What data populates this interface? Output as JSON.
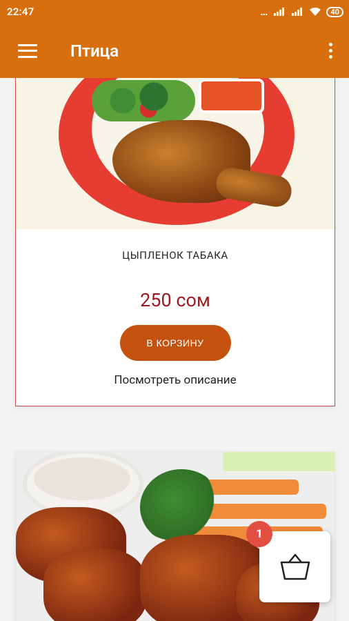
{
  "status_bar": {
    "time": "22:47",
    "battery": "40"
  },
  "app_bar": {
    "title": "Птица"
  },
  "products": [
    {
      "name": "ЦЫПЛЕНОК ТАБАКА",
      "price": "250 сом",
      "add_button": "В КОРЗИНУ",
      "description_link": "Посмотреть описание"
    }
  ],
  "cart": {
    "count": "1"
  },
  "icons": [
    "menu-icon",
    "overflow-menu-icon",
    "shopping-basket-icon",
    "signal-icon",
    "wifi-icon",
    "battery-icon"
  ],
  "colors": {
    "app_bar": "#d86f0f",
    "button": "#c4520e",
    "price": "#9f1b1f",
    "badge": "#e24e41",
    "card_border": "#c64d4d"
  }
}
